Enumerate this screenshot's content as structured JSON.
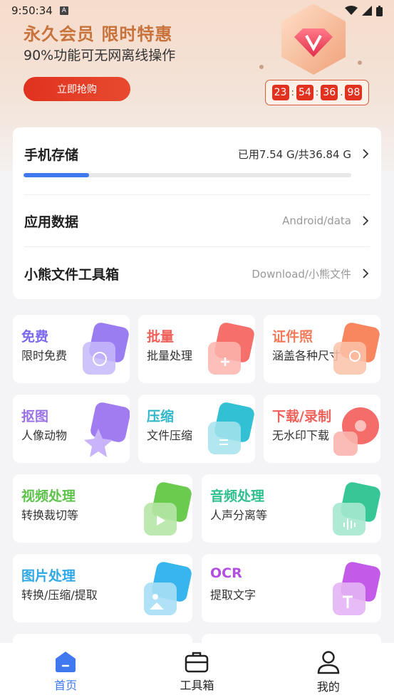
{
  "status_bar": {
    "time": "9:50:34",
    "badge": "A"
  },
  "promo": {
    "title": "永久会员 限时特惠",
    "subtitle": "90%功能可无网离线操作",
    "button_label": "立即抢购",
    "countdown": [
      "23",
      "54",
      "36",
      "98"
    ]
  },
  "storage": {
    "phone": {
      "label": "手机存储",
      "value": "已用7.54 G/共36.84 G",
      "used_fraction": 0.2
    },
    "app_data": {
      "label": "应用数据",
      "value": "Android/data"
    },
    "toolbox": {
      "label": "小熊文件工具箱",
      "value": "Download/小熊文件"
    }
  },
  "tiles": [
    {
      "title": "免费",
      "subtitle": "限时免费",
      "color": "#7b68ee"
    },
    {
      "title": "批量",
      "subtitle": "批量处理",
      "color": "#f0605a"
    },
    {
      "title": "证件照",
      "subtitle": "涵盖各种尺寸",
      "color": "#f07a5a"
    },
    {
      "title": "抠图",
      "subtitle": "人像动物",
      "color": "#9a72e6"
    },
    {
      "title": "压缩",
      "subtitle": "文件压缩",
      "color": "#2fb6c9"
    },
    {
      "title": "下载/录制",
      "subtitle": "无水印下载",
      "color": "#f0605a"
    },
    {
      "title": "视频处理",
      "subtitle": "转换裁切等",
      "color": "#5dc24a"
    },
    {
      "title": "音频处理",
      "subtitle": "人声分离等",
      "color": "#2fbf8f"
    },
    {
      "title": "图片处理",
      "subtitle": "转换/压缩/提取",
      "color": "#2fa8e6"
    },
    {
      "title": "OCR",
      "subtitle": "提取文字",
      "color": "#b24fe0"
    }
  ],
  "nav": [
    {
      "label": "首页",
      "icon": "home-icon",
      "active": true
    },
    {
      "label": "工具箱",
      "icon": "toolbox-icon",
      "active": false
    },
    {
      "label": "我的",
      "icon": "profile-icon",
      "active": false
    }
  ]
}
